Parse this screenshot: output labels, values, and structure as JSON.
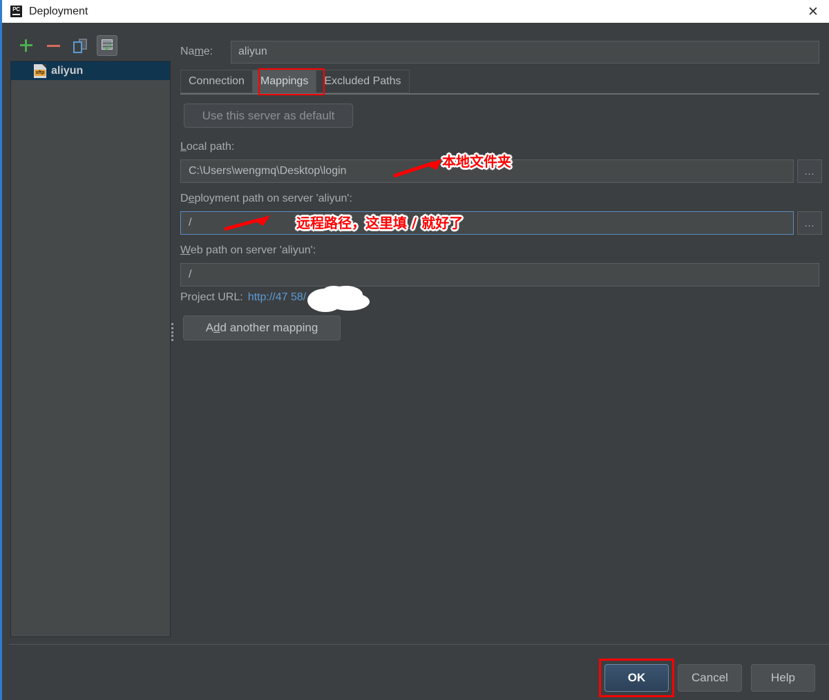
{
  "window": {
    "title": "Deployment",
    "app_icon": "pycharm-icon",
    "close_icon": "close-icon"
  },
  "toolbar": {
    "add_icon": "plus-icon",
    "remove_icon": "minus-icon",
    "copy_icon": "copy-icon",
    "default_server_icon": "server-check-icon"
  },
  "server_list": {
    "items": [
      {
        "label": "aliyun",
        "icon": "sftp-file-icon",
        "selected": true
      }
    ]
  },
  "form": {
    "name_label": "Name:",
    "name_label_prefix": "Na",
    "name_label_mnemonic": "m",
    "name_label_suffix": "e:",
    "name_value": "aliyun"
  },
  "tabs": [
    {
      "label": "Connection",
      "active": false
    },
    {
      "label": "Mappings",
      "active": true
    },
    {
      "label": "Excluded Paths",
      "active": false
    }
  ],
  "mappings": {
    "use_default_button": "Use this server as default",
    "local_path": {
      "label_prefix": "",
      "label_mnemonic": "L",
      "label_suffix": "ocal path:",
      "label": "Local path:",
      "value": "C:\\Users\\wengmq\\Desktop\\login",
      "browse_label": "..."
    },
    "deployment_path": {
      "label_prefix": "D",
      "label_mnemonic": "e",
      "label_suffix": "ployment path on server 'aliyun':",
      "label": "Deployment path on server 'aliyun':",
      "value": "/",
      "browse_label": "...",
      "focused": true
    },
    "web_path": {
      "label_prefix": "",
      "label_mnemonic": "W",
      "label_suffix": "eb path on server 'aliyun':",
      "label": "Web path on server 'aliyun':",
      "value": "/"
    },
    "project_url_label": "Project URL:",
    "project_url_value": "http://47        58/",
    "add_mapping_prefix": "A",
    "add_mapping_mnemonic": "d",
    "add_mapping_suffix": "d another mapping",
    "add_mapping_button": "Add another mapping"
  },
  "footer": {
    "ok": "OK",
    "cancel": "Cancel",
    "help": "Help"
  },
  "annotations": [
    {
      "text": "本地文件夹",
      "kind": "callout-local-folder"
    },
    {
      "text": "远程路径，这里填 / 就好了",
      "kind": "callout-remote-path"
    }
  ],
  "colors": {
    "accent_red": "#ff0000",
    "link_blue": "#5b9bd5",
    "selection_blue": "#10354f",
    "window_bg": "#3c3f41",
    "field_bg": "#45494a"
  }
}
